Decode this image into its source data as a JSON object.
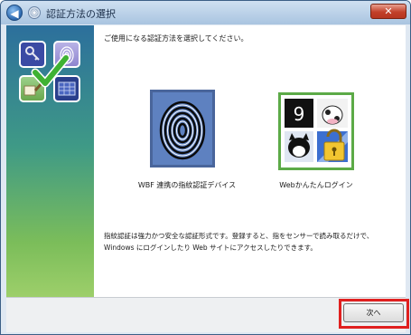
{
  "window": {
    "title": "認証方法の選択",
    "close_label": "✕"
  },
  "content": {
    "instruction": "ご使用になる認証方法を選択してください。",
    "options": [
      {
        "label": "WBF 連携の指紋認証デバイス",
        "icon": "fingerprint-icon"
      },
      {
        "label": "Webかんたんログイン",
        "icon": "web-login-icon"
      }
    ],
    "description": "指紋認証は強力かつ安全な認証形式です。登録すると、指をセンサーで読み取るだけで、Windows にログインしたり Web サイトにアクセスしたりできます。"
  },
  "footer": {
    "next_label": "次へ"
  },
  "colors": {
    "highlight": "#e0201f",
    "fingerprint_border": "#49659b",
    "web_border": "#5caa47"
  }
}
